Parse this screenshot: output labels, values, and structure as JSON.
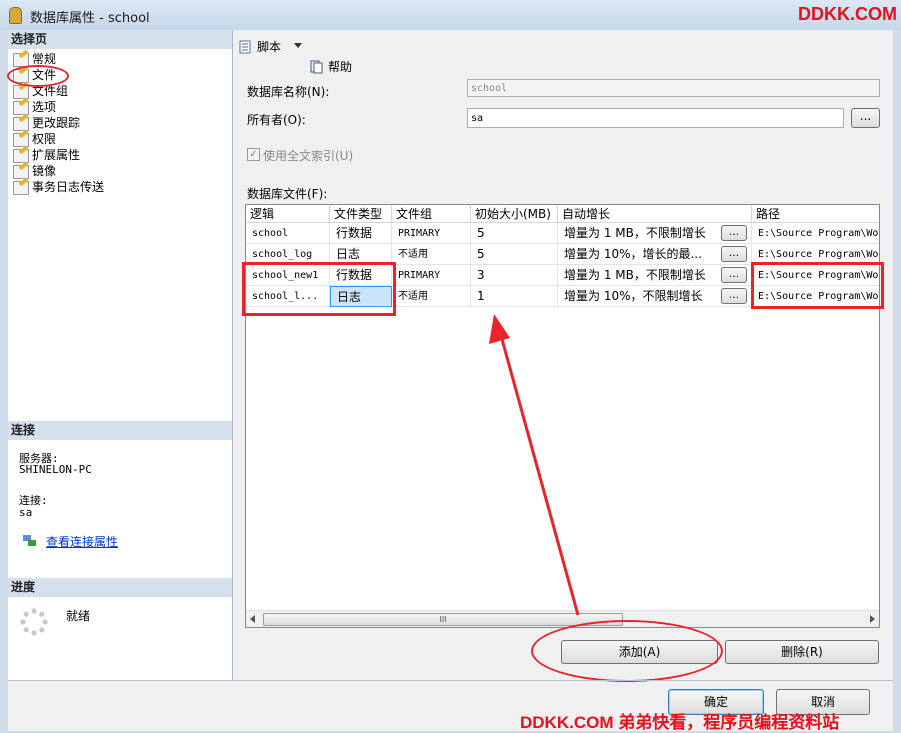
{
  "window": {
    "title": "数据库属性 - school"
  },
  "watermark": {
    "top": "DDKK.COM",
    "bottom": "DDKK.COM 弟弟快看，程序员编程资料站"
  },
  "left": {
    "select_page_header": "选择页",
    "pages": [
      "常规",
      "文件",
      "文件组",
      "选项",
      "更改跟踪",
      "权限",
      "扩展属性",
      "镜像",
      "事务日志传送"
    ],
    "connection_header": "连接",
    "server_label": "服务器:",
    "server_value": "SHINELON-PC",
    "connection_label": "连接:",
    "connection_value": "sa",
    "view_link": "查看连接属性",
    "progress_header": "进度",
    "progress_status": "就绪"
  },
  "toolbar": {
    "script_label": "脚本",
    "help_label": "帮助"
  },
  "form": {
    "db_name_label": "数据库名称(N):",
    "db_name_value": "school",
    "owner_label": "所有者(O):",
    "owner_value": "sa",
    "browse_label": "...",
    "fulltext_label": "使用全文索引(U)",
    "fulltext_checked": true,
    "files_label": "数据库文件(F):"
  },
  "grid": {
    "columns": [
      "逻辑",
      "文件类型",
      "文件组",
      "初始大小(MB)",
      "自动增长",
      "路径"
    ],
    "rows": [
      [
        "school",
        "行数据",
        "PRIMARY",
        "5",
        "增量为 1 MB，不限制增长",
        "E:\\Source Program\\Wo"
      ],
      [
        "school_log",
        "日志",
        "不适用",
        "5",
        "增量为 10%，增长的最...",
        "E:\\Source Program\\Wo"
      ],
      [
        "school_new1",
        "行数据",
        "PRIMARY",
        "3",
        "增量为 1 MB，不限制增长",
        "E:\\Source Program\\Wo"
      ],
      [
        "school_l...",
        "日志",
        "不适用",
        "1",
        "增量为 10%，不限制增长",
        "E:\\Source Program\\Wo"
      ]
    ],
    "cell_button": "...",
    "scroll_thumb": "III"
  },
  "buttons": {
    "add": "添加(A)",
    "remove": "删除(R)",
    "ok": "确定",
    "cancel": "取消"
  },
  "colors": {
    "annotation": "#e8232a",
    "accent": "#3399ff"
  }
}
